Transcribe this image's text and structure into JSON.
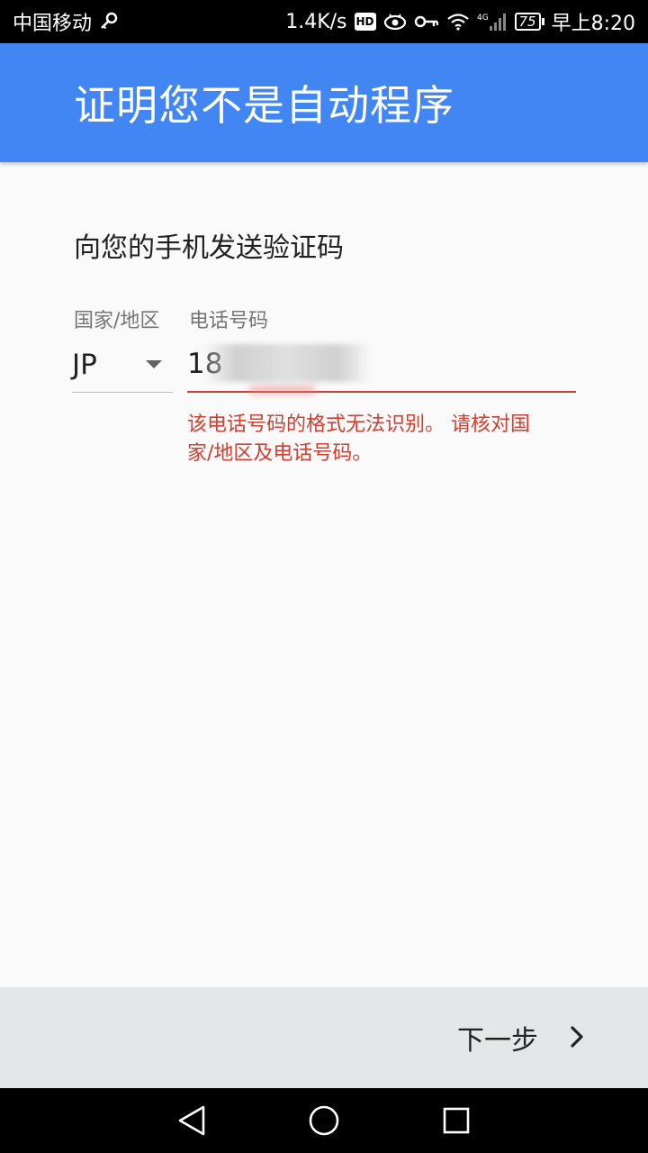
{
  "status_bar": {
    "carrier": "中国移动",
    "speed": "1.4K/s",
    "hd_badge": "HD",
    "network_type": "4G",
    "battery": "75",
    "time": "早上8:20"
  },
  "app_bar": {
    "title": "证明您不是自动程序"
  },
  "form": {
    "subtitle": "向您的手机发送验证码",
    "country_label": "国家/地区",
    "phone_label": "电话号码",
    "country_value": "JP",
    "phone_value": "18",
    "error_message": "该电话号码的格式无法识别。 请核对国家/地区及电话号码。"
  },
  "action_bar": {
    "next_label": "下一步"
  },
  "icons": {
    "key": "key-icon",
    "eye": "eye-icon",
    "vpn": "vpn-key-icon",
    "wifi": "wifi-icon",
    "signal": "signal-icon",
    "battery": "battery-icon",
    "chevron": "chevron-right-icon",
    "back": "back-icon",
    "home": "home-icon",
    "recents": "recents-icon"
  },
  "colors": {
    "app_bar": "#4286f3",
    "error": "#d23f31",
    "action_bar": "#e4e6e8"
  }
}
